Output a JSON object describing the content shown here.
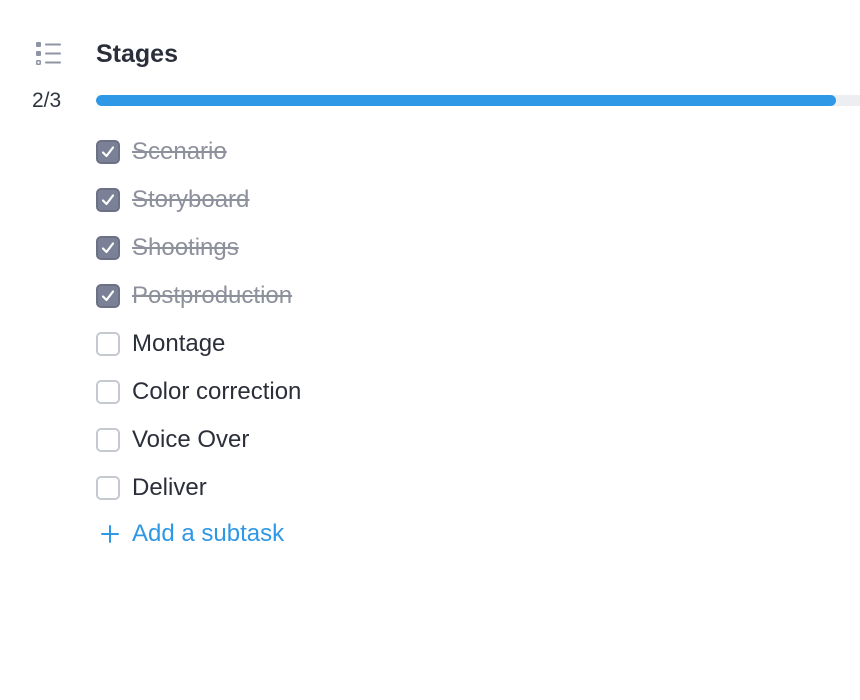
{
  "section": {
    "title": "Stages",
    "icon": "checklist-icon"
  },
  "progress": {
    "label": "2/3",
    "fraction": 0.969
  },
  "stages": [
    {
      "label": "Scenario",
      "checked": true
    },
    {
      "label": "Storyboard",
      "checked": true
    },
    {
      "label": "Shootings",
      "checked": true
    },
    {
      "label": "Postproduction",
      "checked": true
    },
    {
      "label": "Montage",
      "checked": false
    },
    {
      "label": "Color correction",
      "checked": false
    },
    {
      "label": "Voice Over",
      "checked": false
    },
    {
      "label": "Deliver",
      "checked": false
    }
  ],
  "add_subtask": {
    "label": "Add a subtask",
    "icon": "plus-icon"
  },
  "colors": {
    "accent": "#2f98e6",
    "checked_box": "#7a8197",
    "text": "#2b2f3a",
    "done_text": "#8d919b"
  }
}
